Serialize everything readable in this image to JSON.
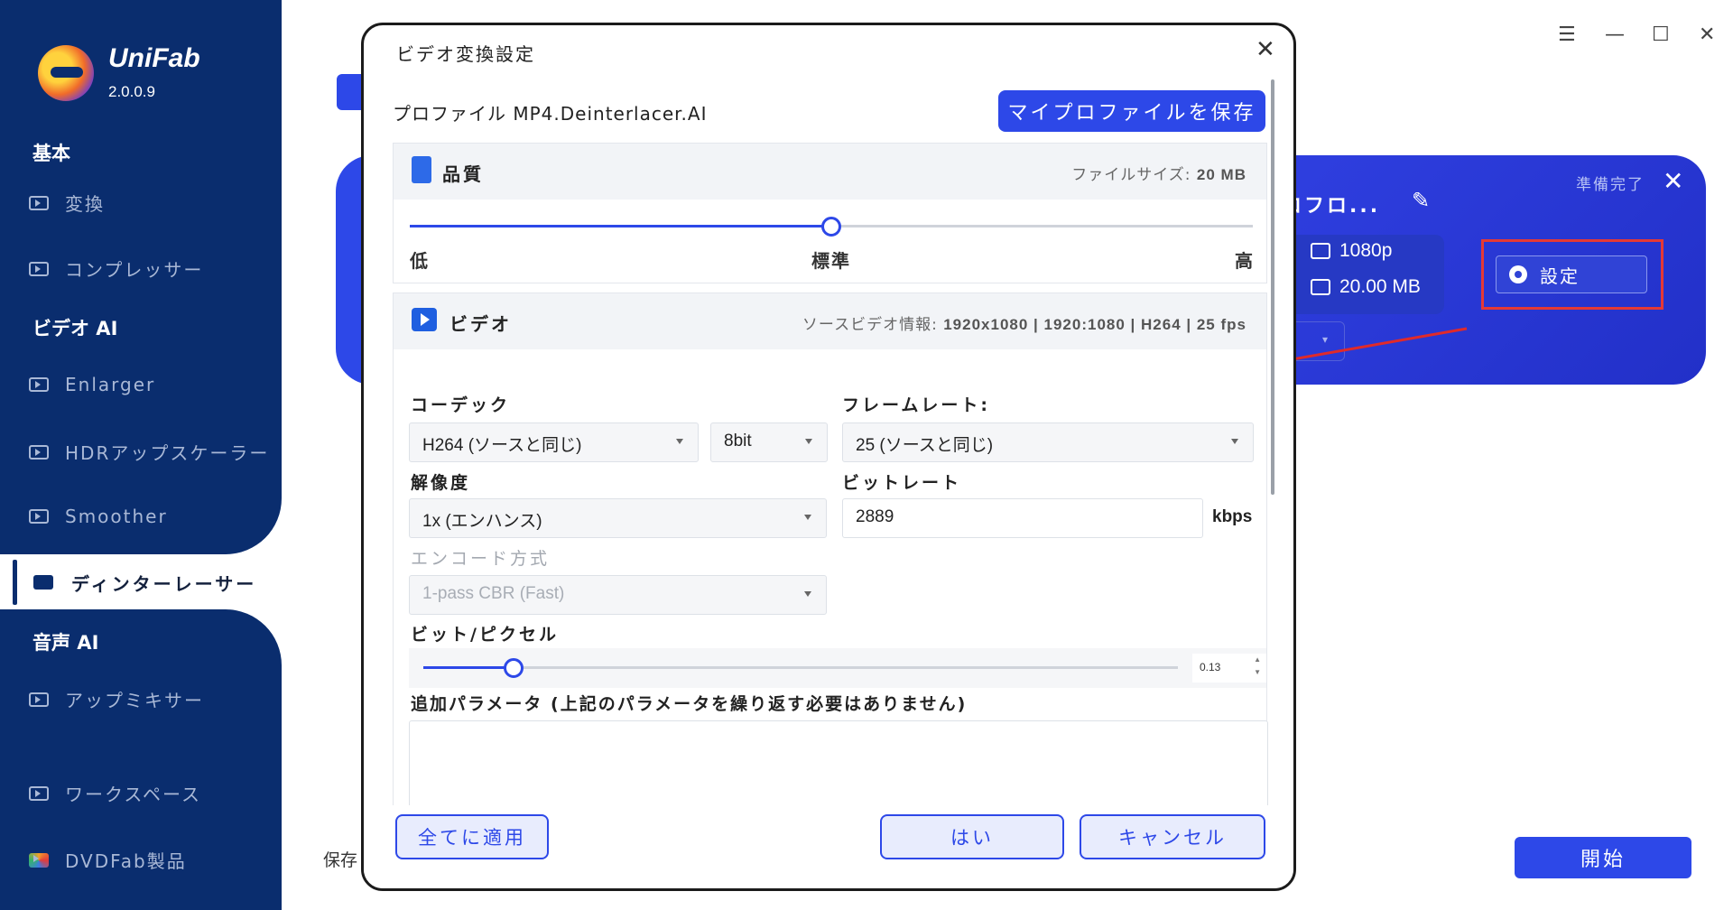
{
  "app": {
    "brand": "UniFab",
    "version": "2.0.0.9"
  },
  "sidebar": {
    "sections": {
      "basic": "基本",
      "video_ai": "ビデオ AI",
      "audio_ai": "音声 AI"
    },
    "items": {
      "convert": "変換",
      "compressor": "コンプレッサー",
      "enlarger": "Enlarger",
      "hdr": "HDRアップスケーラー",
      "smoother": "Smoother",
      "deinterlacer": "ディンターレーサー",
      "upmixer": "アップミキサー",
      "workspace": "ワークスペース",
      "dvdfab": "DVDFab製品"
    }
  },
  "main": {
    "card": {
      "ready": "準備完了",
      "profile": "ロフロ...",
      "resolution": "1080p",
      "size": "20.00 MB",
      "settings_label": "設定"
    },
    "save_to": "保存",
    "start_label": "開始"
  },
  "dialog": {
    "title": "ビデオ変換設定",
    "profile_label": "プロファイル MP4.Deinterlacer.AI",
    "save_profile": "マイプロファイルを保存",
    "quality": {
      "title": "品質",
      "file_size_label": "ファイルサイズ:",
      "file_size": "20 MB",
      "level": 0.5,
      "low": "低",
      "standard": "標準",
      "high": "高"
    },
    "video": {
      "title": "ビデオ",
      "source_info_label": "ソースビデオ情報:",
      "source_info": "1920x1080 | 1920:1080 | H264 | 25 fps",
      "codec_label": "コーデック",
      "codec_value": "H264 (ソースと同じ)",
      "bitdepth_value": "8bit",
      "framerate_label": "フレームレート:",
      "framerate_value": "25 (ソースと同じ)",
      "resolution_label": "解像度",
      "resolution_value": "1x (エンハンス)",
      "bitrate_label": "ビットレート",
      "bitrate_value": "2889",
      "bitrate_unit": "kbps",
      "encode_label": "エンコード方式",
      "encode_value": "1-pass CBR (Fast)",
      "bpp_label": "ビット/ピクセル",
      "bpp_value": "0.13",
      "bpp_level": 0.12,
      "extra_label": "追加パラメータ (上記のパラメータを繰り返す必要はありません)"
    },
    "buttons": {
      "apply_all": "全てに適用",
      "yes": "はい",
      "cancel": "キャンセル"
    }
  },
  "colors": {
    "sidebar": "#0a2d6e",
    "accent": "#2d48e8",
    "highlight": "#e53935"
  }
}
